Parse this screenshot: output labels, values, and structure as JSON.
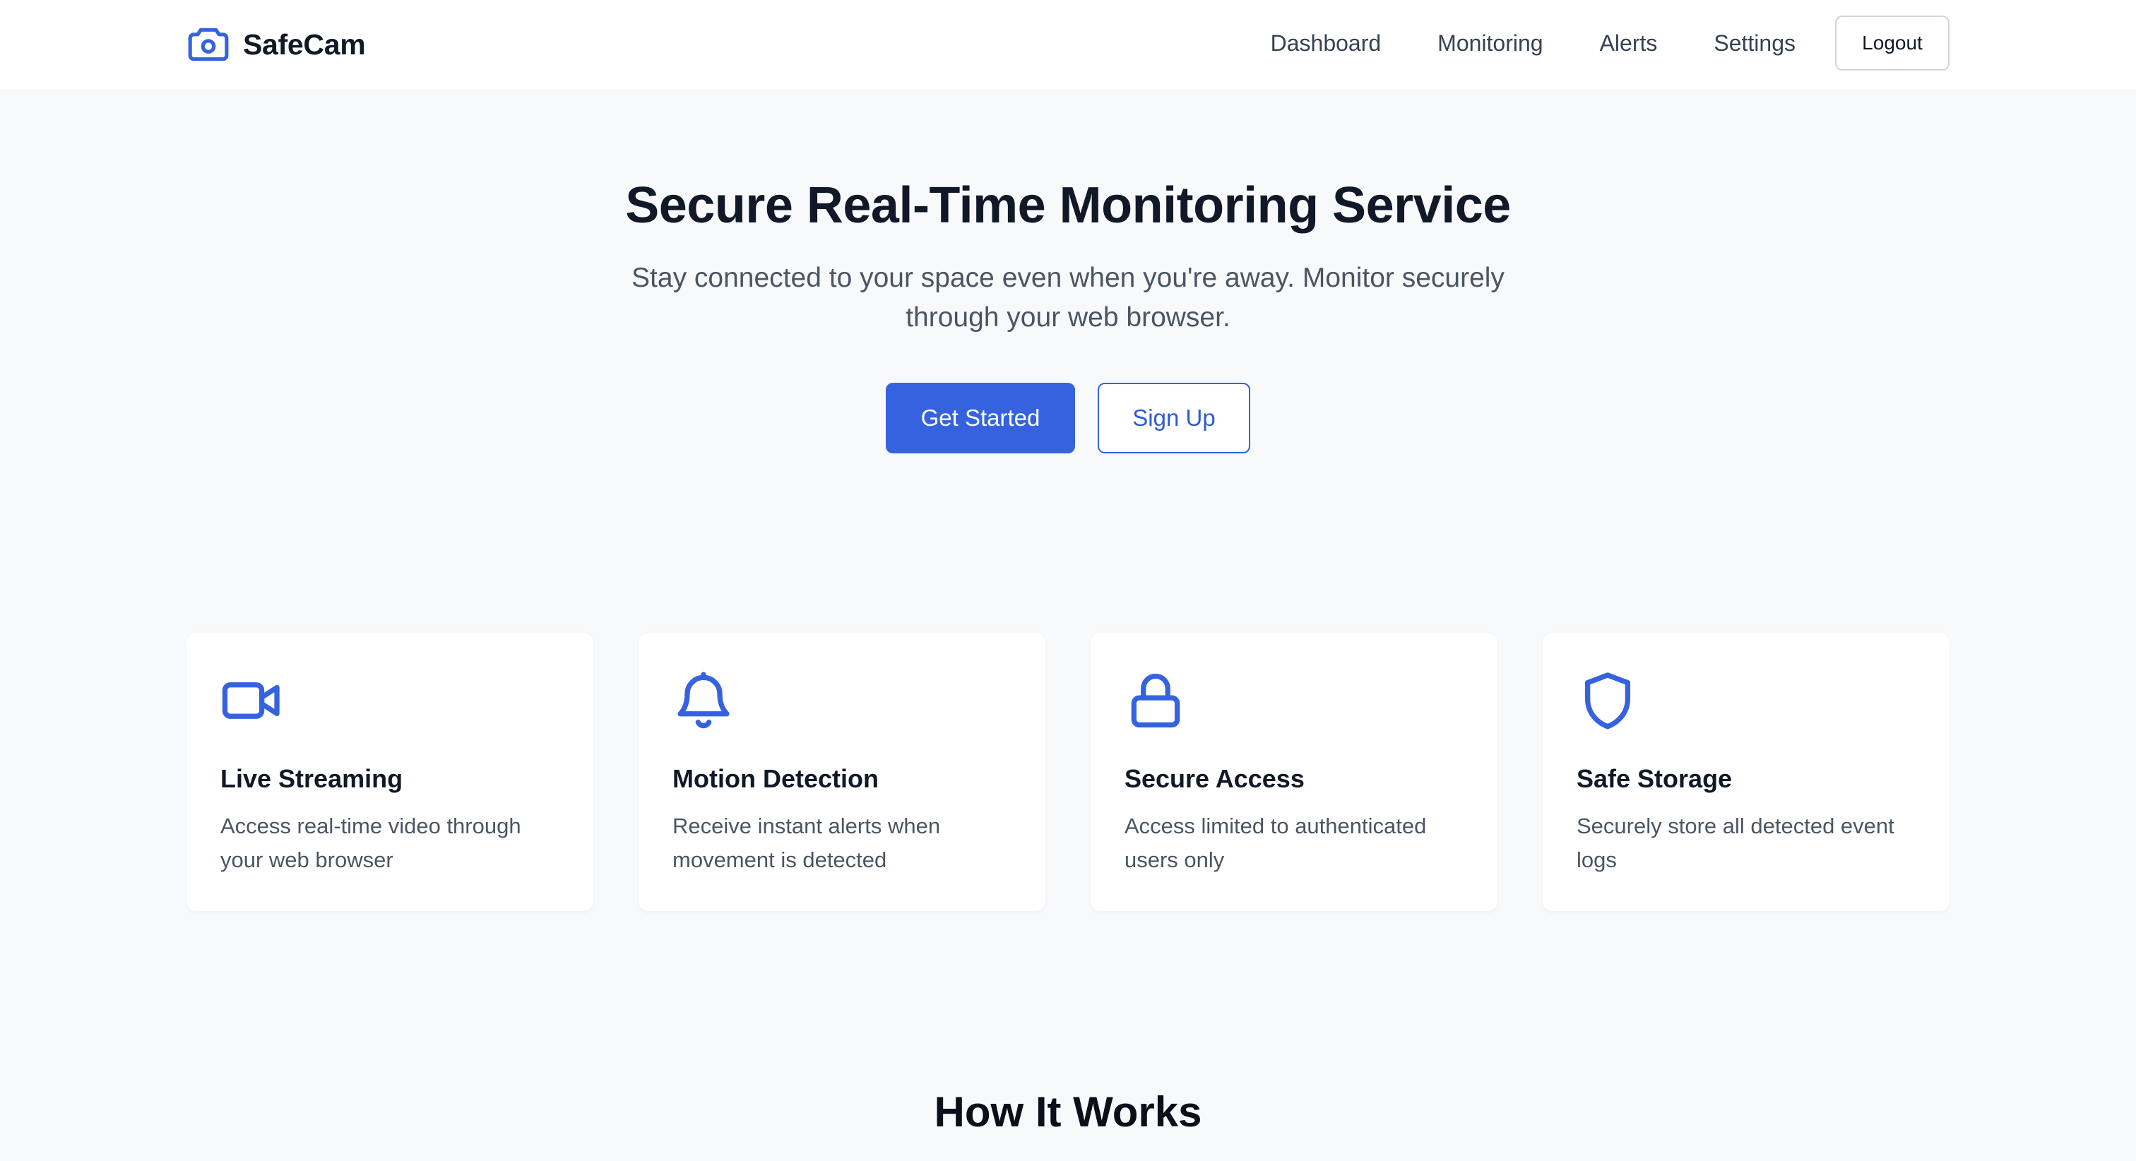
{
  "brand": {
    "name": "SafeCam",
    "icon": "camera-icon",
    "accent_color": "#3563e0"
  },
  "nav": {
    "links": [
      "Dashboard",
      "Monitoring",
      "Alerts",
      "Settings"
    ],
    "logout_label": "Logout"
  },
  "hero": {
    "title": "Secure Real-Time Monitoring Service",
    "subtitle": "Stay connected to your space even when you're away. Monitor securely through your web browser.",
    "primary_button": "Get Started",
    "secondary_button": "Sign Up"
  },
  "features": [
    {
      "icon": "video-camera-icon",
      "title": "Live Streaming",
      "description": "Access real-time video through your web browser"
    },
    {
      "icon": "bell-icon",
      "title": "Motion Detection",
      "description": "Receive instant alerts when movement is detected"
    },
    {
      "icon": "lock-icon",
      "title": "Secure Access",
      "description": "Access limited to authenticated users only"
    },
    {
      "icon": "shield-icon",
      "title": "Safe Storage",
      "description": "Securely store all detected event logs"
    }
  ],
  "how_it_works": {
    "title": "How It Works"
  }
}
